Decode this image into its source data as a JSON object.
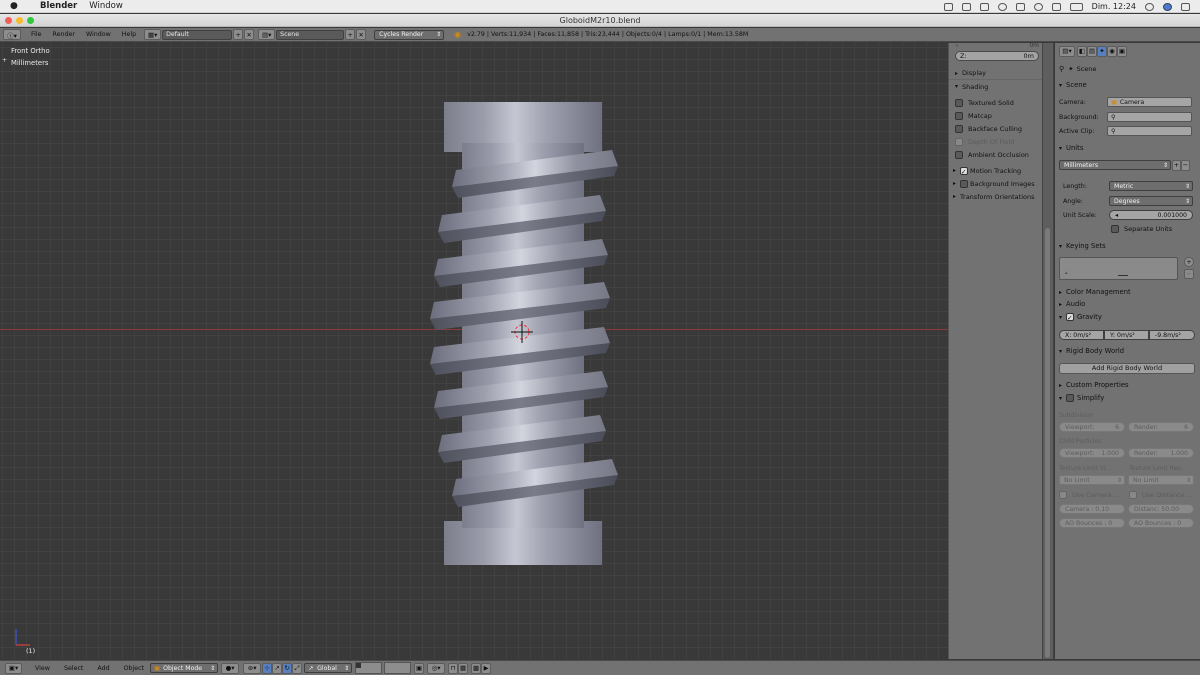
{
  "mac_menubar": {
    "app_name": "Blender",
    "menu_window": "Window",
    "clock": "Dim. 12:24"
  },
  "window": {
    "title": "GloboidM2r10.blend"
  },
  "top_header": {
    "menus": [
      "File",
      "Render",
      "Window",
      "Help"
    ],
    "layout": "Default",
    "scene": "Scene",
    "engine": "Cycles Render",
    "stats": "v2.79 | Verts:11,934 | Faces:11,858 | Tris:23,444 | Objects:0/4 | Lamps:0/1 | Mem:13.58M"
  },
  "viewport": {
    "view_name": "Front Ortho",
    "units_label": "Millimeters",
    "frame": "(1)"
  },
  "npanel": {
    "z_label": "Z:",
    "z_value": "0m",
    "top_value": "0m",
    "display": "Display",
    "shading": "Shading",
    "textured_solid": "Textured Solid",
    "matcap": "Matcap",
    "backface_culling": "Backface Culling",
    "depth_of_field": "Depth Of Field",
    "ambient_occlusion": "Ambient Occlusion",
    "motion_tracking": "Motion Tracking",
    "background_images": "Background Images",
    "transform_orientations": "Transform Orientations"
  },
  "props": {
    "breadcrumb": "Scene",
    "scene_section": "Scene",
    "camera_label": "Camera:",
    "camera_value": "Camera",
    "background_label": "Background:",
    "active_clip_label": "Active Clip:",
    "units_section": "Units",
    "units_preset": "Millimeters",
    "length_label": "Length:",
    "length_value": "Metric",
    "angle_label": "Angle:",
    "angle_value": "Degrees",
    "unit_scale_label": "Unit Scale:",
    "unit_scale_value": "0.001000",
    "separate_units": "Separate Units",
    "keying_sets": "Keying Sets",
    "color_management": "Color Management",
    "audio": "Audio",
    "gravity": "Gravity",
    "grav_x": "X: 0m/s²",
    "grav_y": "Y: 0m/s²",
    "grav_z": "-9.8m/s²",
    "rigid_body_world": "Rigid Body World",
    "add_rigid_body_world": "Add Rigid Body World",
    "custom_properties": "Custom Properties",
    "simplify": "Simplify",
    "subdivision": "Subdivision",
    "viewport_label": "Viewport:",
    "viewport_sub": "6",
    "render_label": "Render:",
    "render_sub": "6",
    "child_particles": "Child Particles",
    "viewport_particles": "1.000",
    "render_particles": "1.000",
    "texture_limit_viewport": "Texture Limit Vi...",
    "texture_limit_render": "Texture Limit Ren...",
    "no_limit": "No Limit",
    "use_camera": "Use Camera ...",
    "use_distance": "Use Distance ...",
    "camera_cull": "Camera : 0.10",
    "distance_cull": "Distanc: 50.00",
    "ao_bounces_vp": "AO Bounces : 0",
    "ao_bounces_r": "AO Bounces : 0"
  },
  "bottom_header": {
    "view": "View",
    "select": "Select",
    "add": "Add",
    "object": "Object",
    "mode": "Object Mode",
    "orientation": "Global"
  },
  "colors": {
    "viewport_bg": "#393939",
    "panel_bg": "#727272",
    "x_axis": "#8a3a3a",
    "mesh_light": "#b9bbc6",
    "mesh_dark": "#7c7e8c"
  }
}
